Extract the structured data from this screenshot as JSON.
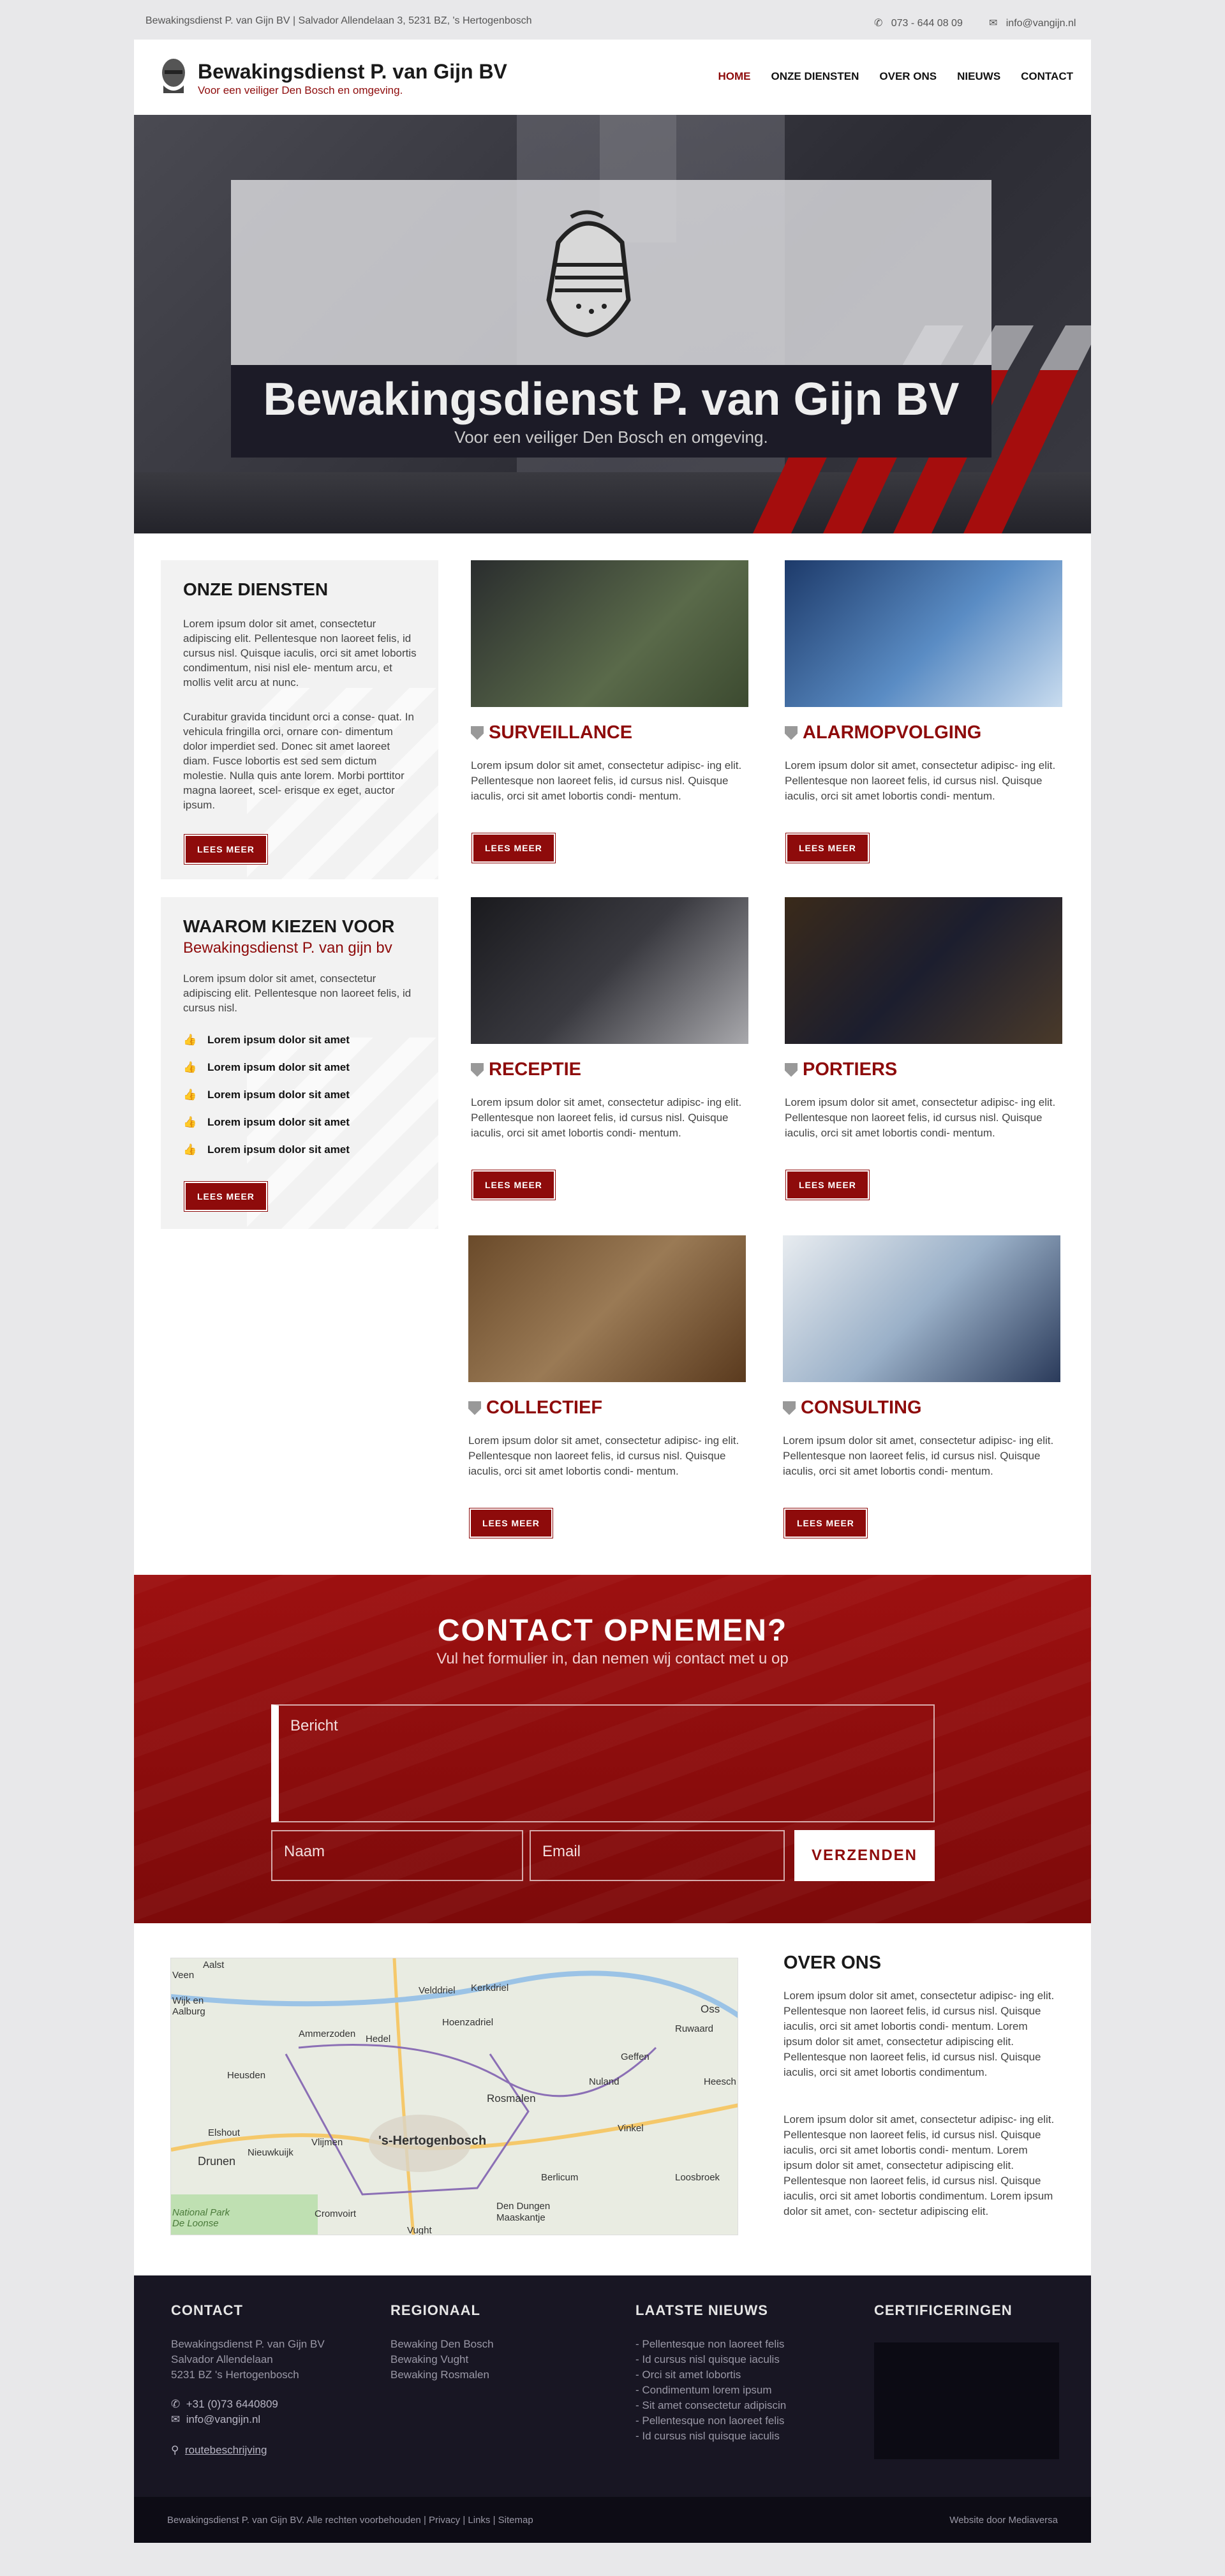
{
  "topbar": {
    "address": "Bewakingsdienst P. van Gijn BV | Salvador Allendelaan  3, 5231 BZ, 's Hertogenbosch",
    "phone": "073 - 644 08 09",
    "email": "info@vangijn.nl",
    "phone_icon": "phone-icon",
    "email_icon": "envelope-icon"
  },
  "header": {
    "site_name": "Bewakingsdienst P. van Gijn BV",
    "tagline": "Voor een veiliger Den Bosch en omgeving.",
    "nav": [
      "HOME",
      "ONZE DIENSTEN",
      "OVER ONS",
      "NIEUWS",
      "CONTACT"
    ],
    "active": "HOME",
    "accent": "#8e0b0b"
  },
  "hero": {
    "title": "Bewakingsdienst P. van Gijn BV",
    "subtitle": "Voor een veiliger Den Bosch en omgeving."
  },
  "onze_diensten": {
    "title": "ONZE DIENSTEN",
    "p1": "Lorem ipsum dolor sit amet, consectetur adipiscing elit. Pellentesque non laoreet felis, id cursus nisl. Quisque iaculis, orci sit amet lobortis condimentum, nisi nisl ele- mentum arcu, et mollis velit arcu at nunc.",
    "p2": "Curabitur gravida tincidunt orci a conse- quat. In vehicula fringilla orci, ornare con- dimentum dolor imperdiet sed. Donec sit amet laoreet diam. Fusce lobortis est sed sem dictum molestie. Nulla quis ante lorem. Morbi porttitor magna laoreet, scel- erisque ex eget, auctor ipsum.",
    "button": "LEES MEER"
  },
  "waarom": {
    "title": "WAAROM KIEZEN VOOR",
    "subtitle": "Bewakingsdienst P. van gijn bv",
    "text": "Lorem ipsum dolor sit amet, consectetur adipiscing elit. Pellentesque non laoreet felis, id cursus nisl.",
    "items": [
      "Lorem ipsum dolor sit amet",
      "Lorem ipsum dolor sit amet",
      "Lorem ipsum dolor sit amet",
      "Lorem ipsum dolor sit amet",
      "Lorem ipsum dolor sit amet"
    ],
    "button": "LEES MEER"
  },
  "services": [
    {
      "title": "SURVEILLANCE",
      "text": "Lorem ipsum dolor sit amet, consectetur adipisc- ing elit. Pellentesque non laoreet felis, id cursus nisl. Quisque iaculis, orci sit amet lobortis condi- mentum.",
      "button": "LEES MEER"
    },
    {
      "title": "ALARMOPVOLGING",
      "text": "Lorem ipsum dolor sit amet, consectetur adipisc- ing elit. Pellentesque non laoreet felis, id cursus nisl. Quisque iaculis, orci sit amet lobortis condi- mentum.",
      "button": "LEES MEER"
    },
    {
      "title": "RECEPTIE",
      "text": "Lorem ipsum dolor sit amet, consectetur adipisc- ing elit. Pellentesque non laoreet felis, id cursus nisl. Quisque iaculis, orci sit amet lobortis condi- mentum.",
      "button": "LEES MEER"
    },
    {
      "title": "PORTIERS",
      "text": "Lorem ipsum dolor sit amet, consectetur adipisc- ing elit. Pellentesque non laoreet felis, id cursus nisl. Quisque iaculis, orci sit amet lobortis condi- mentum.",
      "button": "LEES MEER"
    },
    {
      "title": "COLLECTIEF",
      "text": "Lorem ipsum dolor sit amet, consectetur adipisc- ing elit. Pellentesque non laoreet felis, id cursus nisl. Quisque iaculis, orci sit amet lobortis condi- mentum.",
      "button": "LEES MEER"
    },
    {
      "title": "CONSULTING",
      "text": "Lorem ipsum dolor sit amet, consectetur adipisc- ing elit. Pellentesque non laoreet felis, id cursus nisl. Quisque iaculis, orci sit amet lobortis condi- mentum.",
      "button": "LEES MEER"
    }
  ],
  "contact": {
    "title": "CONTACT OPNEMEN?",
    "subtitle": "Vul het formulier in, dan nemen wij contact met u op",
    "message_placeholder": "Bericht",
    "name_placeholder": "Naam",
    "email_placeholder": "Email",
    "submit": "VERZENDEN"
  },
  "map": {
    "labels": [
      "Aalst",
      "Veen",
      "Wijk en Aalburg",
      "Velddriel",
      "Kerkdriel",
      "Hoenzadriel",
      "Oss",
      "Ruwaard",
      "Ammerzoden",
      "Hedel",
      "Geffen",
      "Heusden",
      "Nuland",
      "Heesch",
      "Rosmalen",
      "Elshout",
      "Vinkel",
      "Drunen",
      "Nieuwkuijk",
      "Vlijmen",
      "'s-Hertogenbosch",
      "Berlicum",
      "Loosbroek",
      "National Park De Loonse",
      "Cromvoirt",
      "Den Dungen",
      "Maaskantje",
      "Vught"
    ]
  },
  "over": {
    "title": "OVER ONS",
    "p1": "Lorem ipsum dolor sit amet, consectetur adipisc- ing elit. Pellentesque non laoreet felis, id cursus nisl. Quisque iaculis, orci sit amet lobortis condi- mentum. Lorem ipsum dolor sit amet, consectetur adipiscing elit. Pellentesque non laoreet felis, id cursus nisl. Quisque iaculis, orci sit amet lobortis condimentum.",
    "p2": "Lorem ipsum dolor sit amet, consectetur adipisc- ing elit. Pellentesque non laoreet felis, id cursus nisl. Quisque iaculis, orci sit amet lobortis condi- mentum. Lorem ipsum dolor sit amet, consectetur adipiscing elit. Pellentesque non laoreet felis, id cursus nisl. Quisque iaculis, orci sit amet lobortis condimentum. Lorem ipsum dolor sit amet, con- sectetur adipiscing elit."
  },
  "footer": {
    "contact_title": "CONTACT",
    "company": "Bewakingsdienst P. van Gijn BV",
    "street": "Salvador Allendelaan",
    "city": "5231 BZ 's Hertogenbosch",
    "phone": "+31 (0)73 6440809",
    "email": "info@vangijn.nl",
    "route": "routebeschrijving",
    "regionaal_title": "REGIONAAL",
    "regionaal": [
      "Bewaking Den Bosch",
      "Bewaking Vught",
      "Bewaking Rosmalen"
    ],
    "nieuws_title": "LAATSTE NIEUWS",
    "nieuws": [
      "- Pellentesque non laoreet felis",
      "- Id cursus nisl quisque iaculis",
      "- Orci sit amet lobortis",
      "- Condimentum lorem ipsum",
      "- Sit amet consectetur adipiscin",
      "- Pellentesque non laoreet felis",
      "- Id cursus nisl quisque iaculis"
    ],
    "cert_title": "CERTIFICERINGEN"
  },
  "bottombar": {
    "left": "Bewakingsdienst P. van Gijn BV. Alle rechten voorbehouden | Privacy | Links | Sitemap",
    "right": "Website door Mediaversa"
  }
}
